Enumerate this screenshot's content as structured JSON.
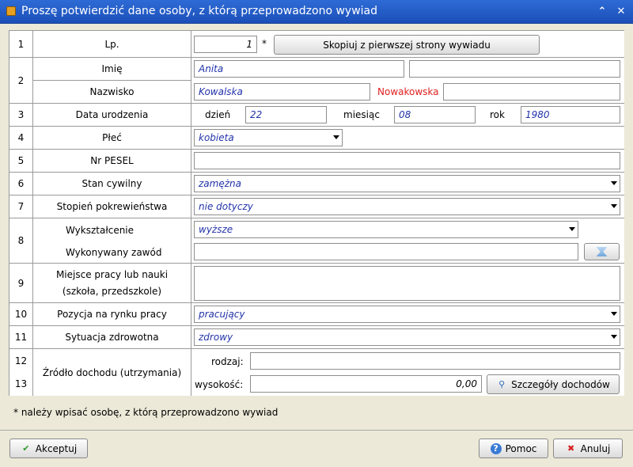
{
  "window": {
    "title": "Proszę potwierdzić dane osoby, z którą przeprowadzono wywiad"
  },
  "rows": {
    "r1": {
      "num": "1",
      "label": "Lp.",
      "value": "1",
      "asterisk": "*",
      "copy_button": "Skopiuj z pierwszej strony wywiadu"
    },
    "r2": {
      "num": "2",
      "first_name_label": "Imię",
      "first_name": "Anita",
      "first_name2": "",
      "surname_label": "Nazwisko",
      "surname": "Kowalska",
      "maiden_label": "Nowakowska",
      "maiden_value": ""
    },
    "r3": {
      "num": "3",
      "label": "Data urodzenia",
      "day_label": "dzień",
      "day": "22",
      "month_label": "miesiąc",
      "month": "08",
      "year_label": "rok",
      "year": "1980"
    },
    "r4": {
      "num": "4",
      "label": "Płeć",
      "value": "kobieta"
    },
    "r5": {
      "num": "5",
      "label": "Nr PESEL",
      "value": ""
    },
    "r6": {
      "num": "6",
      "label": "Stan cywilny",
      "value": "zamężna"
    },
    "r7": {
      "num": "7",
      "label": "Stopień pokrewieństwa",
      "value": "nie dotyczy"
    },
    "r8": {
      "num": "8",
      "education_label": "Wykształcenie",
      "education": "wyższe",
      "profession_label": "Wykonywany zawód",
      "profession": ""
    },
    "r9": {
      "num": "9",
      "label_line1": "Miejsce pracy lub nauki",
      "label_line2": "(szkoła, przedszkole)",
      "value": ""
    },
    "r10": {
      "num": "10",
      "label": "Pozycja na rynku pracy",
      "value": "pracujący"
    },
    "r11": {
      "num": "11",
      "label": "Sytuacja zdrowotna",
      "value": "zdrowy"
    },
    "r12": {
      "num12": "12",
      "num13": "13",
      "label": "Źródło dochodu (utrzymania)",
      "kind_label": "rodzaj:",
      "kind": "",
      "amount_label": "wysokość:",
      "amount": "0,00",
      "details_button": "Szczegóły dochodów"
    }
  },
  "footnote": "* należy wpisać osobę, z którą przeprowadzono wywiad",
  "buttons": {
    "accept": "Akceptuj",
    "help": "Pomoc",
    "cancel": "Anuluj"
  }
}
